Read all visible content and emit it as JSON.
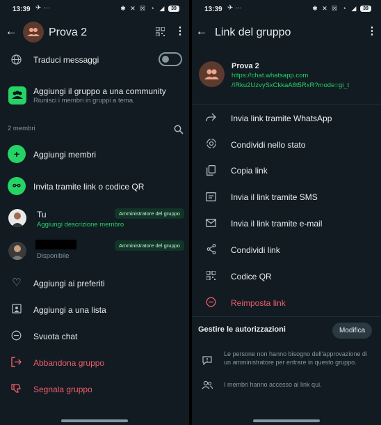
{
  "status": {
    "time_left": "13:39",
    "time_right": "13:39",
    "extra": "✈ ···",
    "battery": "39"
  },
  "left": {
    "header_title": "Prova 2",
    "translate_label": "Traduci messaggi",
    "community_title": "Aggiungi il gruppo a una community",
    "community_sub": "Riunisci i membri in gruppi a tema.",
    "members_count": "2 membri",
    "add_members": "Aggiungi membri",
    "invite_link": "Invita tramite link o codice QR",
    "member1_name": "Tu",
    "member1_desc": "Aggiungi descrizione membro",
    "member2_status": "Disponibile",
    "admin_badge": "Amministratore del gruppo",
    "add_favorites": "Aggiungi ai preferiti",
    "add_list": "Aggiungi a una lista",
    "clear_chat": "Svuota chat",
    "leave_group": "Abbandona gruppo",
    "report_group": "Segnala gruppo"
  },
  "right": {
    "header_title": "Link del gruppo",
    "group_name": "Prova 2",
    "link_line1": "https://chat.whatsapp.com",
    "link_line2": "/IRku2UzvySxCkkaA8t5RxR?mode=gi_t",
    "send_whatsapp": "Invia link tramite WhatsApp",
    "share_status": "Condividi nello stato",
    "copy_link": "Copia link",
    "send_sms": "Invia il link tramite SMS",
    "send_email": "Invia il link tramite e-mail",
    "share_link": "Condividi link",
    "qr_code": "Codice QR",
    "reset_link": "Reimposta link",
    "permissions_title": "Gestire le autorizzazioni",
    "modify_button": "Modifica",
    "perm1": "Le persone non hanno bisogno dell'approvazione di un amministratore per entrare in questo gruppo.",
    "perm2": "I membri hanno accesso al link qui."
  },
  "colors": {
    "background": "#111b21",
    "accent_green": "#25d366",
    "danger_red": "#f15c6d",
    "text_primary": "#e9edef",
    "text_secondary": "#8696a0"
  },
  "icons": {
    "back": "arrow-left-icon",
    "qr": "qr-code-icon",
    "more": "more-vertical-icon",
    "globe": "globe-icon",
    "community": "community-icon",
    "search": "search-icon",
    "add_member": "add-person-icon",
    "link": "link-icon",
    "heart": "heart-icon",
    "list": "list-icon",
    "clear": "minus-circle-icon",
    "exit": "exit-icon",
    "report": "thumbs-down-icon",
    "forward": "forward-icon",
    "status": "status-icon",
    "copy": "copy-icon",
    "sms": "sms-icon",
    "email": "email-icon",
    "share": "share-icon",
    "reset": "minus-circle-icon",
    "approval": "alert-box-icon",
    "members": "members-icon"
  }
}
